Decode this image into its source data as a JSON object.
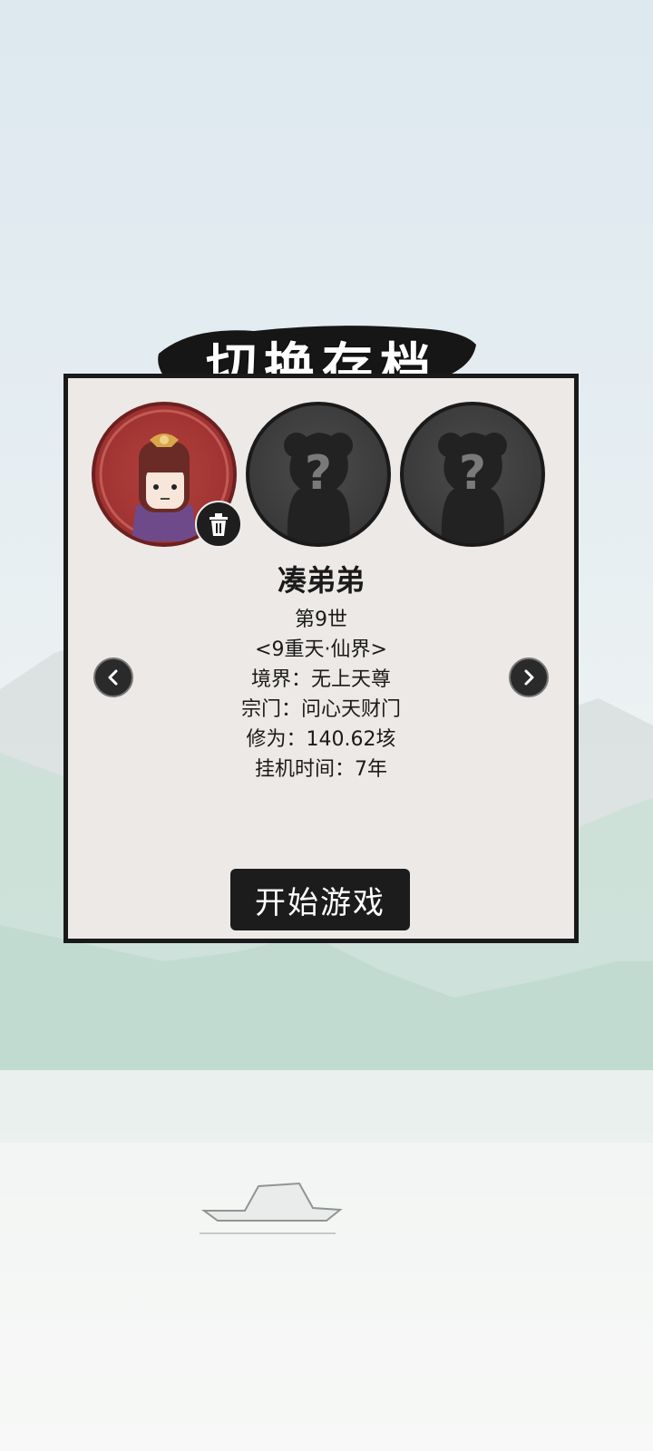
{
  "title": "切换存档",
  "slots": [
    {
      "state": "occupied",
      "icon": "character-portrait-icon"
    },
    {
      "state": "empty",
      "icon": "unknown-silhouette-icon"
    },
    {
      "state": "empty",
      "icon": "unknown-silhouette-icon"
    }
  ],
  "delete_icon": "trash-icon",
  "character": {
    "name": "凑弟弟",
    "generation": "第9世",
    "realm_zone": "<9重天·仙界>",
    "realm": "境界：无上天尊",
    "sect": "宗门：问心天财门",
    "cultivation": "修为：140.62垓",
    "idle_time": "挂机时间：7年"
  },
  "nav": {
    "prev_icon": "chevron-left-icon",
    "next_icon": "chevron-right-icon"
  },
  "start_button": "开始游戏",
  "colors": {
    "panel": "#ece9e6",
    "ink": "#1a1a1a",
    "avatar_red": "#a23533",
    "slot_dark": "#3a3a3a"
  }
}
